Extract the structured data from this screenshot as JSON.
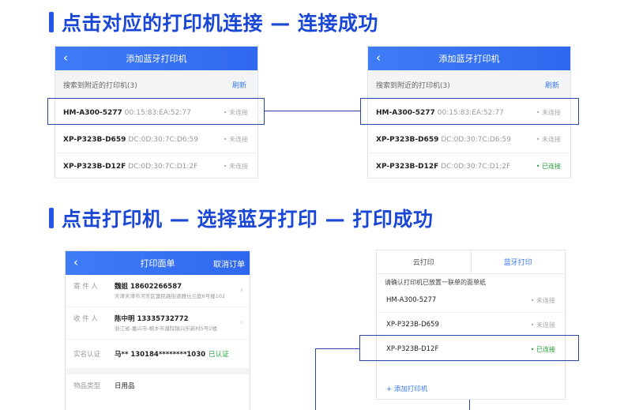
{
  "section1": {
    "title": "点击对应的打印机连接 — 连接成功"
  },
  "section2": {
    "title": "点击打印机 — 选择蓝牙打印 — 打印成功"
  },
  "add_printer_screen": {
    "back_icon": "‹",
    "title": "添加蓝牙打印机",
    "search_label": "搜索到附近的打印机(3)",
    "refresh_label": "刷新"
  },
  "devices_before": [
    {
      "name": "HM-A300-5277",
      "mac": "00:15:83:EA:52:77",
      "status": "• 未连接"
    },
    {
      "name": "XP-P323B-D659",
      "mac": "DC:0D:30:7C:D6:59",
      "status": "• 未连接"
    },
    {
      "name": "XP-P323B-D12F",
      "mac": "DC:0D:30:7C:D1:2F",
      "status": "• 未连接"
    }
  ],
  "devices_after": [
    {
      "name": "HM-A300-5277",
      "mac": "00:15:83:EA:52:77",
      "status": "• 未连接"
    },
    {
      "name": "XP-P323B-D659",
      "mac": "DC:0D:30:7C:D6:59",
      "status": "• 未连接"
    },
    {
      "name": "XP-P323B-D12F",
      "mac": "DC:0D:30:7C:D1:2F",
      "status": "• 已连接"
    }
  ],
  "print_form": {
    "back_icon": "‹",
    "title": "打印面单",
    "cancel_label": "取消订单",
    "sender": {
      "label": "寄 件 人",
      "name": "魏姐  18602266587",
      "address": "天津天津市河东区富民路街道雅仕兰庭6号楼102"
    },
    "receiver": {
      "label": "收 件 人",
      "name": "陈中明  13335732772",
      "address": "浙江省-嘉兴市-桐乡市濮院镇兴乐新村5号2楼"
    },
    "verify": {
      "label": "实名认证",
      "value": "马**  130184********1030",
      "badge": "已认证"
    },
    "goods": {
      "label": "物品类型",
      "value": "日用品"
    },
    "chevron": "›"
  },
  "print_select": {
    "tab_cloud": "云打印",
    "tab_bluetooth": "蓝牙打印",
    "note": "请确认打印机已放置一联单的面单纸",
    "printers": [
      {
        "name": "HM-A300-5277",
        "status": "• 未连接"
      },
      {
        "name": "XP-P323B-D659",
        "status": "• 未连接"
      },
      {
        "name": "XP-P323B-D12F",
        "status": "• 已连接"
      }
    ],
    "add_label": "+ 添加打印机"
  }
}
